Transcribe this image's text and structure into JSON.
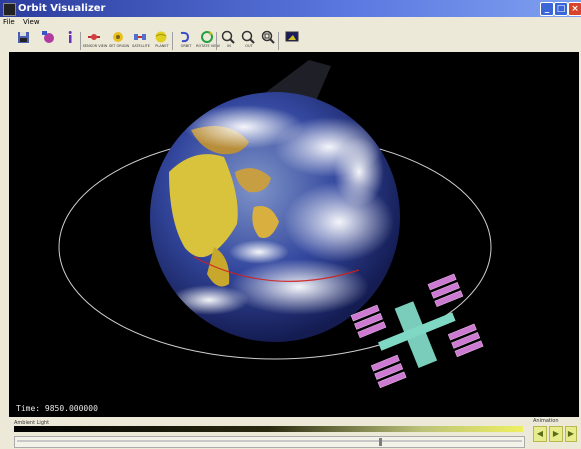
{
  "window": {
    "title": "Orbit Visualizer",
    "min": "_",
    "max": "□",
    "close": "×"
  },
  "menu": {
    "file": "File",
    "view": "View"
  },
  "toolbar": {
    "tools": [
      {
        "name": "save-tool",
        "icon": "save-disk-icon",
        "label": ""
      },
      {
        "name": "render-tool",
        "icon": "render-icon",
        "label": ""
      },
      {
        "name": "info-tool",
        "icon": "info-icon",
        "label": ""
      },
      {
        "name": "sensor-tool",
        "icon": "sensor-icon",
        "label": "SENSOR VIEW"
      },
      {
        "name": "setorigin-tool",
        "icon": "origin-icon",
        "label": "SET ORIGIN"
      },
      {
        "name": "satellite-tool",
        "icon": "satellite-icon",
        "label": "SATELLITE"
      },
      {
        "name": "planet-tool",
        "icon": "planet-icon",
        "label": "PLANET"
      },
      {
        "name": "orbit-tool",
        "icon": "orbit-icon",
        "label": "ORBIT"
      },
      {
        "name": "rotate-tool",
        "icon": "rotate-icon",
        "label": "ROTATE VIEW"
      },
      {
        "name": "zoom-in-tool",
        "icon": "zoom-in-icon",
        "label": "IN"
      },
      {
        "name": "zoom-out-tool",
        "icon": "zoom-out-icon",
        "label": "OUT"
      },
      {
        "name": "zoom-fit-tool",
        "icon": "zoom-fit-icon",
        "label": ""
      },
      {
        "name": "display-tool",
        "icon": "display-icon",
        "label": ""
      }
    ]
  },
  "viewport": {
    "time": "Time: 9850.000000"
  },
  "controls": {
    "ambient_label": "Ambient Light",
    "animation_label": "Animation",
    "ambient_level": 0.72,
    "buttons": {
      "rewind": "◀",
      "play": "▶",
      "forward": "▶"
    }
  },
  "colors": {
    "accent": "#e7ec8d",
    "earth_ocean": "#2a3a98",
    "station_panel": "#cc7ad2"
  }
}
